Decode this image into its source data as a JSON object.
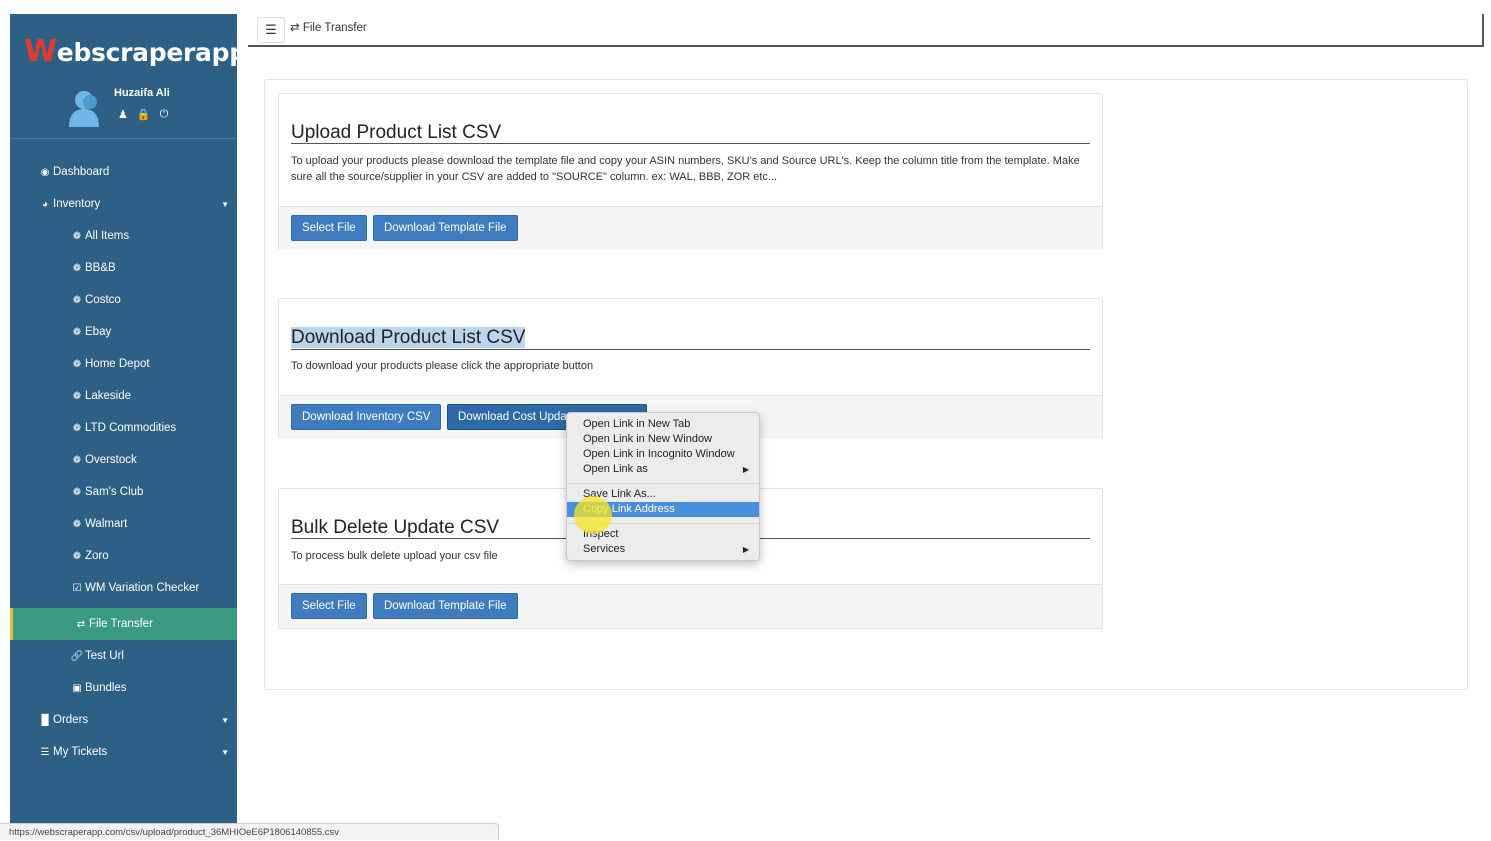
{
  "app": {
    "logo_first": "W",
    "logo_rest": "ebscraperapp"
  },
  "user": {
    "name": "Huzaifa Ali",
    "icons": [
      "user-icon",
      "lock-icon",
      "power-icon"
    ]
  },
  "sidebar": {
    "items": [
      {
        "label": "Dashboard",
        "icon": "dashboard-icon"
      },
      {
        "label": "Inventory",
        "icon": "pie-chart-icon"
      },
      {
        "label": "All Items",
        "icon": "bullet-icon"
      },
      {
        "label": "BB&B",
        "icon": "bullet-icon"
      },
      {
        "label": "Costco",
        "icon": "bullet-icon"
      },
      {
        "label": "Ebay",
        "icon": "bullet-icon"
      },
      {
        "label": "Home Depot",
        "icon": "bullet-icon"
      },
      {
        "label": "Lakeside",
        "icon": "bullet-icon"
      },
      {
        "label": "LTD Commodities",
        "icon": "bullet-icon"
      },
      {
        "label": "Overstock",
        "icon": "bullet-icon"
      },
      {
        "label": "Sam's Club",
        "icon": "bullet-icon"
      },
      {
        "label": "Walmart",
        "icon": "bullet-icon"
      },
      {
        "label": "Zoro",
        "icon": "bullet-icon"
      },
      {
        "label": "WM Variation Checker",
        "icon": "checkbox-icon"
      },
      {
        "label": "File Transfer",
        "icon": "exchange-icon"
      },
      {
        "label": "Test Url",
        "icon": "link-icon"
      },
      {
        "label": "Bundles",
        "icon": "cubes-icon"
      },
      {
        "label": "Orders",
        "icon": "bar-chart-icon"
      },
      {
        "label": "My Tickets",
        "icon": "list-icon"
      }
    ]
  },
  "header": {
    "breadcrumb": "File Transfer"
  },
  "upload": {
    "title": "Upload Product List CSV",
    "desc": "To upload your products please download the template file and copy your ASIN numbers, SKU's and Source URL's. Keep the column title from the template. Make sure all the source/supplier in your CSV are added to \"SOURCE\" column. ex: WAL, BBB, ZOR etc...",
    "select_btn": "Select File",
    "template_btn": "Download Template File"
  },
  "download": {
    "title": "Download Product List CSV",
    "desc": "To download your products please click the appropriate button",
    "inventory_btn": "Download Inventory CSV",
    "cost_btn": "Download Cost Upda"
  },
  "bulk": {
    "title": "Bulk Delete Update CSV",
    "desc": "To process bulk delete upload your csv file",
    "select_btn": "Select File",
    "template_btn": "Download Template File"
  },
  "context_menu": {
    "items": [
      "Open Link in New Tab",
      "Open Link in New Window",
      "Open Link in Incognito Window",
      "Open Link as",
      "Save Link As...",
      "Copy Link Address",
      "Inspect",
      "Services"
    ],
    "selected": "Copy Link Address"
  },
  "statusbar": {
    "url": "https://webscraperapp.com/csv/upload/product_36MHIOeE6P1806140855.csv"
  },
  "colors": {
    "sidebar": "#2e5f85",
    "active_item": "#3a9b7e",
    "button": "#3f7cbf",
    "menu_select": "#4a8fdd"
  }
}
